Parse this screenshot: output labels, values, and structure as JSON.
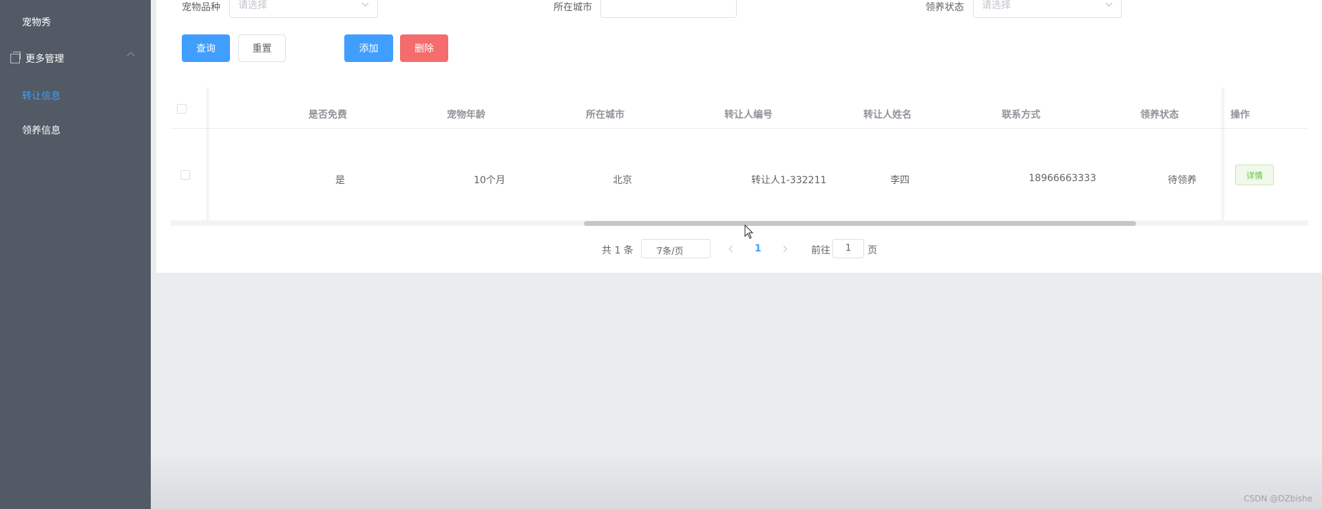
{
  "sidebar": {
    "items": [
      {
        "label": "宠物秀"
      },
      {
        "label": "更多管理",
        "group": true
      },
      {
        "label": "转让信息",
        "active": true
      },
      {
        "label": "领养信息"
      }
    ]
  },
  "search": {
    "fields": [
      {
        "label": "宠物品种",
        "placeholder": "请选择",
        "type": "select"
      },
      {
        "label": "所在城市",
        "value": "",
        "type": "input"
      },
      {
        "label": "领养状态",
        "placeholder": "请选择",
        "type": "select"
      }
    ],
    "buttons": {
      "query": "查询",
      "reset": "重置",
      "add": "添加",
      "delete": "删除"
    }
  },
  "table": {
    "headers": [
      "是否免费",
      "宠物年龄",
      "所在城市",
      "转让人编号",
      "转让人姓名",
      "联系方式",
      "领养状态",
      "操作"
    ],
    "rows": [
      [
        "是",
        "10个月",
        "北京",
        "转让人1-332211",
        "李四",
        "18966663333",
        "待领养"
      ]
    ],
    "detail_label": "详情"
  },
  "pagination": {
    "total_text": "共 1 条",
    "page_size": "7条/页",
    "current_page": "1",
    "goto_label": "前往",
    "goto_value": "1",
    "page_suffix": "页"
  },
  "watermark": "CSDN @DZbishe",
  "colors": {
    "primary": "#409eff",
    "danger": "#f56c6c",
    "success": "#67c23a",
    "sidebar_bg": "#515a65"
  }
}
